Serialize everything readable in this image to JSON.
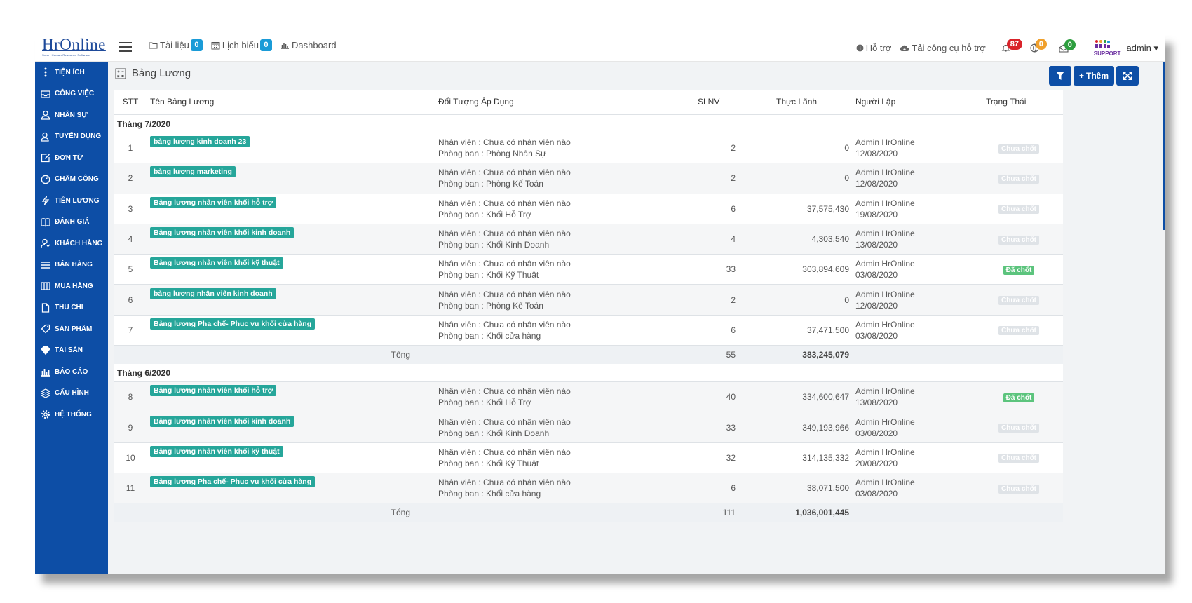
{
  "app": {
    "logo": "HrOnline",
    "logo_sub": "Smart Human Resource Software"
  },
  "topnav": [
    {
      "label": "Tài liệu",
      "count": "0",
      "icon": "folder-icon"
    },
    {
      "label": "Lịch biểu",
      "count": "0",
      "icon": "calendar-icon"
    },
    {
      "label": "Dashboard",
      "count": null,
      "icon": "bar-chart-icon"
    }
  ],
  "tools": {
    "support": "Hỗ trợ",
    "download": "Tải công cụ hỗ trợ",
    "support_logo": "SUPPORT"
  },
  "badges": {
    "bell": "87",
    "globe": "0",
    "mail": "0",
    "colors": {
      "bell": "#d9232a",
      "globe": "#f0a02c",
      "mail": "#2e9e3f"
    }
  },
  "user": {
    "name": "admin"
  },
  "sidebar": [
    {
      "label": "TIỆN ÍCH",
      "icon": "dots-icon"
    },
    {
      "label": "CÔNG VIỆC",
      "icon": "inbox-icon"
    },
    {
      "label": "NHÂN SỰ",
      "icon": "user-icon"
    },
    {
      "label": "TUYỂN DỤNG",
      "icon": "user-add-icon"
    },
    {
      "label": "ĐƠN TỪ",
      "icon": "edit-icon"
    },
    {
      "label": "CHẤM CÔNG",
      "icon": "clock-icon"
    },
    {
      "label": "TIỀN LƯƠNG",
      "icon": "bolt-icon"
    },
    {
      "label": "ĐÁNH GIÁ",
      "icon": "book-icon"
    },
    {
      "label": "KHÁCH HÀNG",
      "icon": "customer-icon"
    },
    {
      "label": "BÁN HÀNG",
      "icon": "list-icon"
    },
    {
      "label": "MUA HÀNG",
      "icon": "columns-icon"
    },
    {
      "label": "THU CHI",
      "icon": "file-icon"
    },
    {
      "label": "SẢN PHẨM",
      "icon": "tag-icon"
    },
    {
      "label": "TÀI SẢN",
      "icon": "diamond-icon"
    },
    {
      "label": "BÁO CÁO",
      "icon": "report-icon"
    },
    {
      "label": "CẤU HÌNH",
      "icon": "layers-icon"
    },
    {
      "label": "HỆ THỐNG",
      "icon": "gear-icon"
    }
  ],
  "page": {
    "title": "Bảng Lương",
    "add_label": "Thêm"
  },
  "columns": [
    "STT",
    "Tên Bảng Lương",
    "Đối Tượng Áp Dụng",
    "SLNV",
    "Thực Lãnh",
    "Người Lập",
    "Trạng Thái"
  ],
  "groups": [
    {
      "title": "Tháng 7/2020",
      "total_label": "Tổng",
      "total_slnv": "55",
      "total_thuc": "383,245,079",
      "rows": [
        {
          "stt": "1",
          "name": "bảng lương kinh doanh 23",
          "nv": "Nhân viên : Chưa có nhân viên nào",
          "pb": "Phòng ban : Phòng Nhân Sự",
          "slnv": "2",
          "thuc": "0",
          "nguoi": "Admin HrOnline",
          "date": "12/08/2020",
          "status": "Chưa chốt",
          "status_color": "gray"
        },
        {
          "stt": "2",
          "name": "bảng lương marketing",
          "nv": "Nhân viên : Chưa có nhân viên nào",
          "pb": "Phòng ban : Phòng Kế Toán",
          "slnv": "2",
          "thuc": "0",
          "nguoi": "Admin HrOnline",
          "date": "12/08/2020",
          "status": "Chưa chốt",
          "status_color": "gray"
        },
        {
          "stt": "3",
          "name": "Bảng lương nhân viên khối hỗ trợ",
          "nv": "Nhân viên : Chưa có nhân viên nào",
          "pb": "Phòng ban : Khối Hỗ Trợ",
          "slnv": "6",
          "thuc": "37,575,430",
          "nguoi": "Admin HrOnline",
          "date": "19/08/2020",
          "status": "Chưa chốt",
          "status_color": "gray"
        },
        {
          "stt": "4",
          "name": "Bảng lương nhân viên khối kinh doanh",
          "nv": "Nhân viên : Chưa có nhân viên nào",
          "pb": "Phòng ban : Khối Kinh Doanh",
          "slnv": "4",
          "thuc": "4,303,540",
          "nguoi": "Admin HrOnline",
          "date": "13/08/2020",
          "status": "Chưa chốt",
          "status_color": "gray"
        },
        {
          "stt": "5",
          "name": "Bảng lương nhân viên khối kỹ thuật",
          "nv": "Nhân viên : Chưa có nhân viên nào",
          "pb": "Phòng ban : Khối Kỹ Thuật",
          "slnv": "33",
          "thuc": "303,894,609",
          "nguoi": "Admin HrOnline",
          "date": "03/08/2020",
          "status": "Đã chốt",
          "status_color": "green"
        },
        {
          "stt": "6",
          "name": "bảng lương nhân viên kinh doanh",
          "nv": "Nhân viên : Chưa có nhân viên nào",
          "pb": "Phòng ban : Phòng Kế Toán",
          "slnv": "2",
          "thuc": "0",
          "nguoi": "Admin HrOnline",
          "date": "12/08/2020",
          "status": "Chưa chốt",
          "status_color": "gray"
        },
        {
          "stt": "7",
          "name": "Bảng lương Pha chế- Phục vụ khối cửa hàng",
          "nv": "Nhân viên : Chưa có nhân viên nào",
          "pb": "Phòng ban : Khối cửa hàng",
          "slnv": "6",
          "thuc": "37,471,500",
          "nguoi": "Admin HrOnline",
          "date": "03/08/2020",
          "status": "Chưa chốt",
          "status_color": "gray"
        }
      ]
    },
    {
      "title": "Tháng 6/2020",
      "total_label": "Tổng",
      "total_slnv": "111",
      "total_thuc": "1,036,001,445",
      "rows": [
        {
          "stt": "8",
          "name": "Bảng lương nhân viên khối hỗ trợ",
          "nv": "Nhân viên : Chưa có nhân viên nào",
          "pb": "Phòng ban : Khối Hỗ Trợ",
          "slnv": "40",
          "thuc": "334,600,647",
          "nguoi": "Admin HrOnline",
          "date": "13/08/2020",
          "status": "Đã chốt",
          "status_color": "green"
        },
        {
          "stt": "9",
          "name": "Bảng lương nhân viên khối kinh doanh",
          "nv": "Nhân viên : Chưa có nhân viên nào",
          "pb": "Phòng ban : Khối Kinh Doanh",
          "slnv": "33",
          "thuc": "349,193,966",
          "nguoi": "Admin HrOnline",
          "date": "03/08/2020",
          "status": "Chưa chốt",
          "status_color": "gray"
        },
        {
          "stt": "10",
          "name": "Bảng lương nhân viên khối kỹ thuật",
          "nv": "Nhân viên : Chưa có nhân viên nào",
          "pb": "Phòng ban : Khối Kỹ Thuật",
          "slnv": "32",
          "thuc": "314,135,332",
          "nguoi": "Admin HrOnline",
          "date": "20/08/2020",
          "status": "Chưa chốt",
          "status_color": "gray"
        },
        {
          "stt": "11",
          "name": "Bảng lương Pha chế- Phục vụ khối cửa hàng",
          "nv": "Nhân viên : Chưa có nhân viên nào",
          "pb": "Phòng ban : Khối cửa hàng",
          "slnv": "6",
          "thuc": "38,071,500",
          "nguoi": "Admin HrOnline",
          "date": "03/08/2020",
          "status": "Chưa chốt",
          "status_color": "gray"
        }
      ]
    }
  ]
}
